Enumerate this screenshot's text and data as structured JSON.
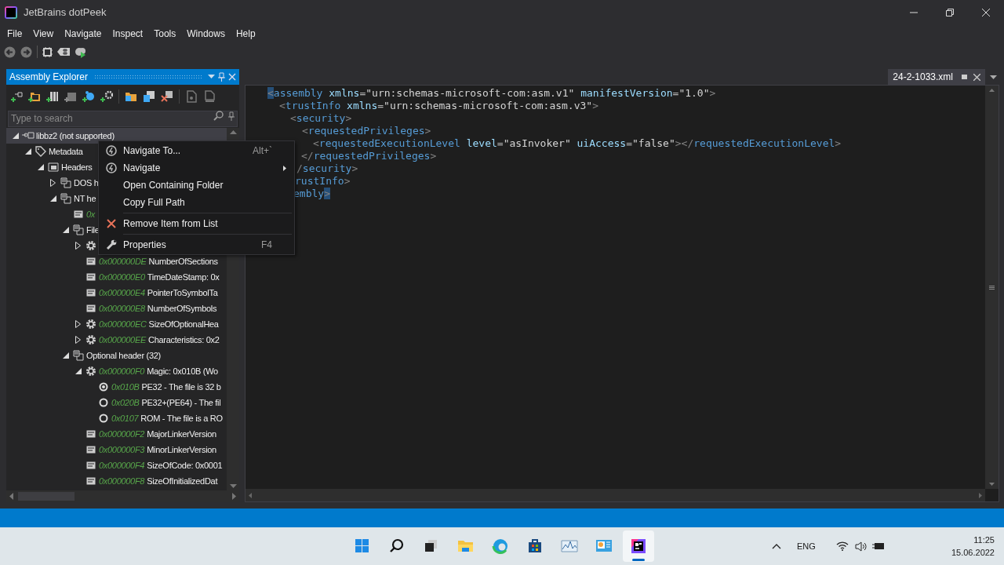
{
  "window": {
    "title": "JetBrains dotPeek"
  },
  "menu_bar": [
    "File",
    "View",
    "Navigate",
    "Inspect",
    "Tools",
    "Windows",
    "Help"
  ],
  "assembly_explorer": {
    "title": "Assembly Explorer",
    "search": {
      "placeholder": "Type to search"
    },
    "tree": [
      {
        "kind": "assembly",
        "label": "libbz2 (not supported)",
        "expanded": true,
        "selected": true,
        "children": [
          {
            "kind": "metadata",
            "label": "Metadata",
            "expanded": true,
            "selected": false,
            "children": [
              {
                "kind": "folder",
                "label": "Headers",
                "expanded": true,
                "selected": false,
                "children": [
                  {
                    "kind": "header",
                    "label": "DOS h",
                    "expanded": false,
                    "selected": false
                  },
                  {
                    "kind": "header",
                    "label": "NT he",
                    "expanded": true,
                    "selected": false,
                    "children": [
                      {
                        "kind": "field",
                        "offset": "0x",
                        "selected": false
                      },
                      {
                        "kind": "header",
                        "label": "File",
                        "expanded": true,
                        "selected": false,
                        "children": [
                          {
                            "kind": "gear",
                            "expanded": false,
                            "selected": false
                          },
                          {
                            "kind": "field",
                            "offset": "0x000000DE",
                            "label": "NumberOfSections",
                            "selected": false
                          },
                          {
                            "kind": "field",
                            "offset": "0x000000E0",
                            "label": "TimeDateStamp: 0x",
                            "selected": false
                          },
                          {
                            "kind": "field",
                            "offset": "0x000000E4",
                            "label": "PointerToSymbolTa",
                            "selected": false
                          },
                          {
                            "kind": "field",
                            "offset": "0x000000E8",
                            "label": "NumberOfSymbols",
                            "selected": false
                          },
                          {
                            "kind": "gear",
                            "offset": "0x000000EC",
                            "label": "SizeOfOptionalHea",
                            "expanded": false,
                            "selected": false
                          },
                          {
                            "kind": "gear",
                            "offset": "0x000000EE",
                            "label": "Characteristics: 0x2",
                            "expanded": false,
                            "selected": false
                          }
                        ]
                      },
                      {
                        "kind": "header",
                        "label": "Optional header (32)",
                        "expanded": true,
                        "selected": false,
                        "children": [
                          {
                            "kind": "gear",
                            "offset": "0x000000F0",
                            "label": "Magic: 0x010B (Wo",
                            "expanded": true,
                            "selected": false,
                            "children": [
                              {
                                "kind": "radio",
                                "offset": "0x010B",
                                "label": "PE32 - The file is 32 b",
                                "checked": true,
                                "selected": false
                              },
                              {
                                "kind": "radio",
                                "offset": "0x020B",
                                "label": "PE32+(PE64) - The fil",
                                "checked": false,
                                "selected": false
                              },
                              {
                                "kind": "radio",
                                "offset": "0x0107",
                                "label": "ROM - The file is a RO",
                                "checked": false,
                                "selected": false
                              }
                            ]
                          },
                          {
                            "kind": "field",
                            "offset": "0x000000F2",
                            "label": "MajorLinkerVersion",
                            "selected": false
                          },
                          {
                            "kind": "field",
                            "offset": "0x000000F3",
                            "label": "MinorLinkerVersion",
                            "selected": false
                          },
                          {
                            "kind": "field",
                            "offset": "0x000000F4",
                            "label": "SizeOfCode: 0x0001",
                            "selected": false
                          },
                          {
                            "kind": "field",
                            "offset": "0x000000F8",
                            "label": "SizeOfInitializedDat",
                            "selected": false
                          }
                        ]
                      }
                    ]
                  }
                ]
              }
            ]
          }
        ]
      }
    ]
  },
  "context_menu": {
    "items": [
      {
        "kind": "navigate",
        "label": "Navigate To...",
        "shortcut": "Alt+`"
      },
      {
        "kind": "navigate",
        "label": "Navigate",
        "submenu": true
      },
      {
        "kind": "plain",
        "label": "Open Containing Folder"
      },
      {
        "kind": "plain",
        "label": "Copy Full Path"
      },
      {
        "kind": "separator"
      },
      {
        "kind": "remove",
        "label": "Remove Item from List"
      },
      {
        "kind": "separator"
      },
      {
        "kind": "properties",
        "label": "Properties",
        "shortcut": "F4"
      }
    ]
  },
  "editor": {
    "tab": {
      "label": "24-2-1033.xml",
      "selected": true
    },
    "lines": [
      {
        "tokens": [
          {
            "kind": "bracket",
            "text": "<",
            "highlighted": true
          },
          {
            "kind": "tag",
            "text": "assembly"
          },
          {
            "kind": "attr",
            "text": "xmlns"
          },
          {
            "kind": "eq",
            "text": "="
          },
          {
            "kind": "value",
            "text": "\"urn:schemas-microsoft-com:asm.v1\""
          },
          {
            "kind": "attr",
            "text": "manifestVersion"
          },
          {
            "kind": "eq",
            "text": "="
          },
          {
            "kind": "value",
            "text": "\"1.0\""
          },
          {
            "kind": "bracket",
            "text": ">",
            "highlighted": false
          }
        ]
      },
      {
        "tokens": [
          {
            "kind": "bracket",
            "text": "<",
            "highlighted": false
          },
          {
            "kind": "tag",
            "text": "trustInfo"
          },
          {
            "kind": "attr",
            "text": "xmlns"
          },
          {
            "kind": "eq",
            "text": "="
          },
          {
            "kind": "value",
            "text": "\"urn:schemas-microsoft-com:asm.v3\""
          },
          {
            "kind": "bracket",
            "text": ">",
            "highlighted": false
          }
        ]
      },
      {
        "tokens": [
          {
            "kind": "bracket",
            "text": "<",
            "highlighted": false
          },
          {
            "kind": "tag",
            "text": "security"
          },
          {
            "kind": "bracket",
            "text": ">",
            "highlighted": false
          }
        ]
      },
      {
        "tokens": [
          {
            "kind": "bracket",
            "text": "<",
            "highlighted": false
          },
          {
            "kind": "tag",
            "text": "requestedPrivileges"
          },
          {
            "kind": "bracket",
            "text": ">",
            "highlighted": false
          }
        ]
      },
      {
        "tokens": [
          {
            "kind": "bracket",
            "text": "<",
            "highlighted": false
          },
          {
            "kind": "tag",
            "text": "requestedExecutionLevel"
          },
          {
            "kind": "attr",
            "text": "level"
          },
          {
            "kind": "eq",
            "text": "="
          },
          {
            "kind": "value",
            "text": "\"asInvoker\""
          },
          {
            "kind": "attr",
            "text": "uiAccess"
          },
          {
            "kind": "eq",
            "text": "="
          },
          {
            "kind": "value",
            "text": "\"false\""
          },
          {
            "kind": "bracket",
            "text": "></",
            "highlighted": false
          },
          {
            "kind": "tag",
            "text": "requestedExecutionLevel"
          },
          {
            "kind": "bracket",
            "text": ">",
            "highlighted": false
          }
        ]
      },
      {
        "tokens": [
          {
            "kind": "bracket",
            "text": "</",
            "highlighted": false
          },
          {
            "kind": "tag",
            "text": "requestedPrivileges"
          },
          {
            "kind": "bracket",
            "text": ">",
            "highlighted": false
          }
        ]
      },
      {
        "tokens": [
          {
            "kind": "bracket",
            "text": "/",
            "highlighted": false
          },
          {
            "kind": "tag",
            "text": "security"
          },
          {
            "kind": "bracket",
            "text": ">",
            "highlighted": false
          }
        ]
      },
      {
        "tokens": [
          {
            "kind": "tag",
            "text": "rustInfo"
          },
          {
            "kind": "bracket",
            "text": ">",
            "highlighted": false
          }
        ]
      },
      {
        "tokens": [
          {
            "kind": "tag",
            "text": "embly"
          },
          {
            "kind": "bracket",
            "text": ">",
            "highlighted": true
          }
        ]
      }
    ]
  },
  "taskbar": {
    "apps": [
      {
        "kind": "start",
        "selected": false
      },
      {
        "kind": "search",
        "selected": false
      },
      {
        "kind": "taskview",
        "selected": false
      },
      {
        "kind": "explorer",
        "selected": false
      },
      {
        "kind": "edge",
        "selected": false
      },
      {
        "kind": "store",
        "selected": false
      },
      {
        "kind": "monitor",
        "selected": false
      },
      {
        "kind": "control",
        "selected": false
      },
      {
        "kind": "dotpeek",
        "selected": true
      }
    ],
    "tray": {
      "language": "ENG",
      "time": "11:25",
      "date": "15.06.2022"
    }
  }
}
